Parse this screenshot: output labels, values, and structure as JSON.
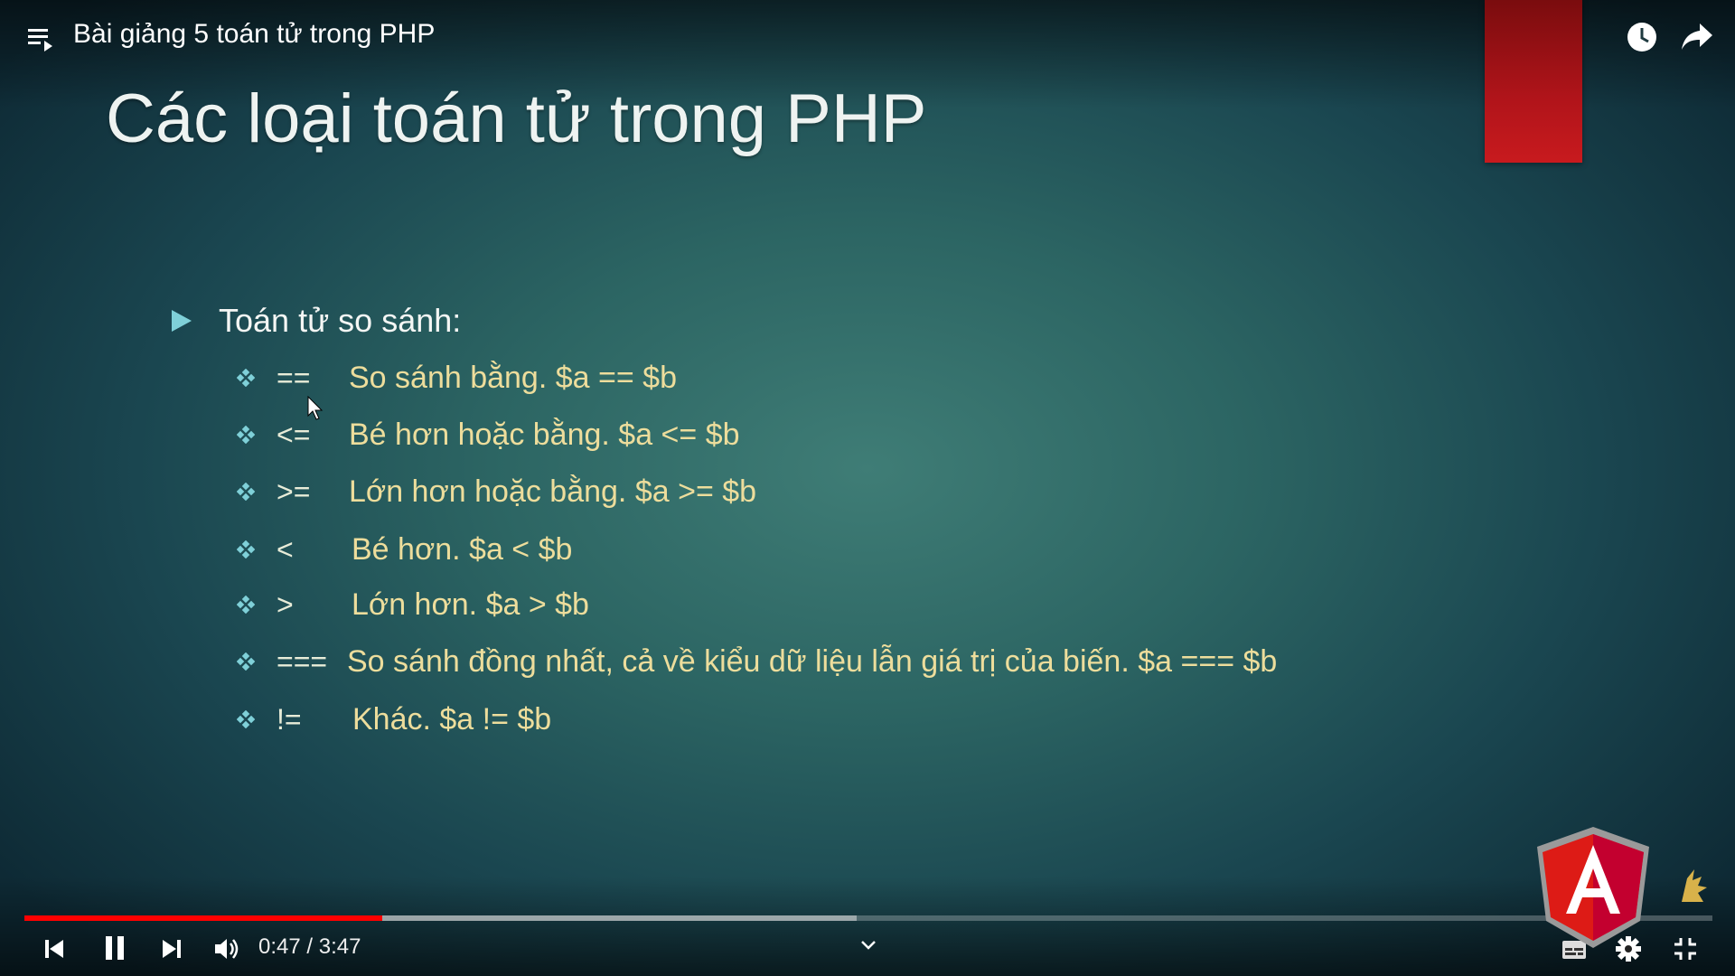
{
  "player": {
    "title": "Bài giảng 5 toán tử trong PHP",
    "time_current": "0:47",
    "time_total": "3:47",
    "time_display": "0:47 / 3:47",
    "progress_played_fraction": 0.212,
    "progress_buffered_fraction": 0.493,
    "colors": {
      "progress": "#ff0000",
      "slide_accent": "#c81a1e"
    },
    "icons": [
      "playlist-icon",
      "clock-icon",
      "share-icon",
      "prev-icon",
      "pause-icon",
      "next-icon",
      "volume-icon",
      "chevron-down-icon",
      "subtitles-icon",
      "settings-icon",
      "exit-fullscreen-icon"
    ]
  },
  "slide": {
    "title": "Các loại toán tử trong PHP",
    "section_label": "Toán tử so sánh:",
    "operators": [
      {
        "symbol": "==",
        "description": "So sánh bằng. $a == $b"
      },
      {
        "symbol": "<=",
        "description": "Bé hơn hoặc bằng. $a <= $b"
      },
      {
        "symbol": ">=",
        "description": "Lớn hơn hoặc bằng. $a >= $b"
      },
      {
        "symbol": "<",
        "description": "Bé hơn. $a < $b"
      },
      {
        "symbol": ">",
        "description": "Lớn hơn. $a > $b"
      },
      {
        "symbol": "===",
        "description": "So sánh đồng nhất, cả về kiểu dữ liệu lẫn giá trị của biến.  $a === $b"
      },
      {
        "symbol": "!=",
        "description": "Khác.  $a != $b"
      }
    ],
    "colors": {
      "title": "#eef3f1",
      "description": "#eddd9c",
      "bullet": "#7fd0d8"
    }
  }
}
